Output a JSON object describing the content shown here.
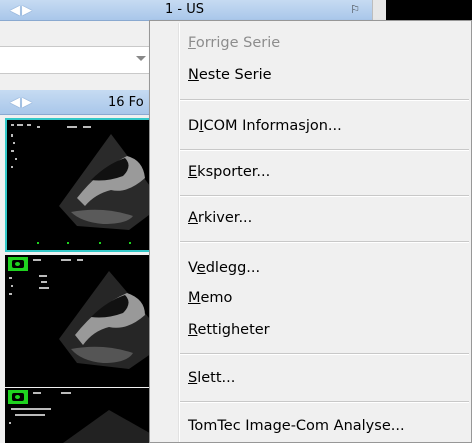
{
  "header1": {
    "title": "1 - US"
  },
  "header2": {
    "title": "16 Fo"
  },
  "context_menu": {
    "items": [
      {
        "label": "Forrige Serie",
        "accel": "F",
        "enabled": false
      },
      {
        "label": "Neste Serie",
        "accel": "N",
        "enabled": true
      },
      {
        "label": "DICOM Informasjon...",
        "accel": "I",
        "enabled": true
      },
      {
        "label": "Eksporter...",
        "accel": "E",
        "enabled": true
      },
      {
        "label": "Arkiver...",
        "accel": "A",
        "enabled": true
      },
      {
        "label": "Vedlegg...",
        "accel": "e",
        "enabled": true
      },
      {
        "label": "Memo",
        "accel": "M",
        "enabled": true
      },
      {
        "label": "Rettigheter",
        "accel": "R",
        "enabled": true
      },
      {
        "label": "Slett...",
        "accel": "S",
        "enabled": true
      },
      {
        "label": "TomTec Image-Com Analyse...",
        "accel": "",
        "enabled": true
      }
    ]
  },
  "colors": {
    "header": "#b3cdec",
    "thumb_selected_border": "#33c8c8",
    "badge": "#1fd21f"
  }
}
